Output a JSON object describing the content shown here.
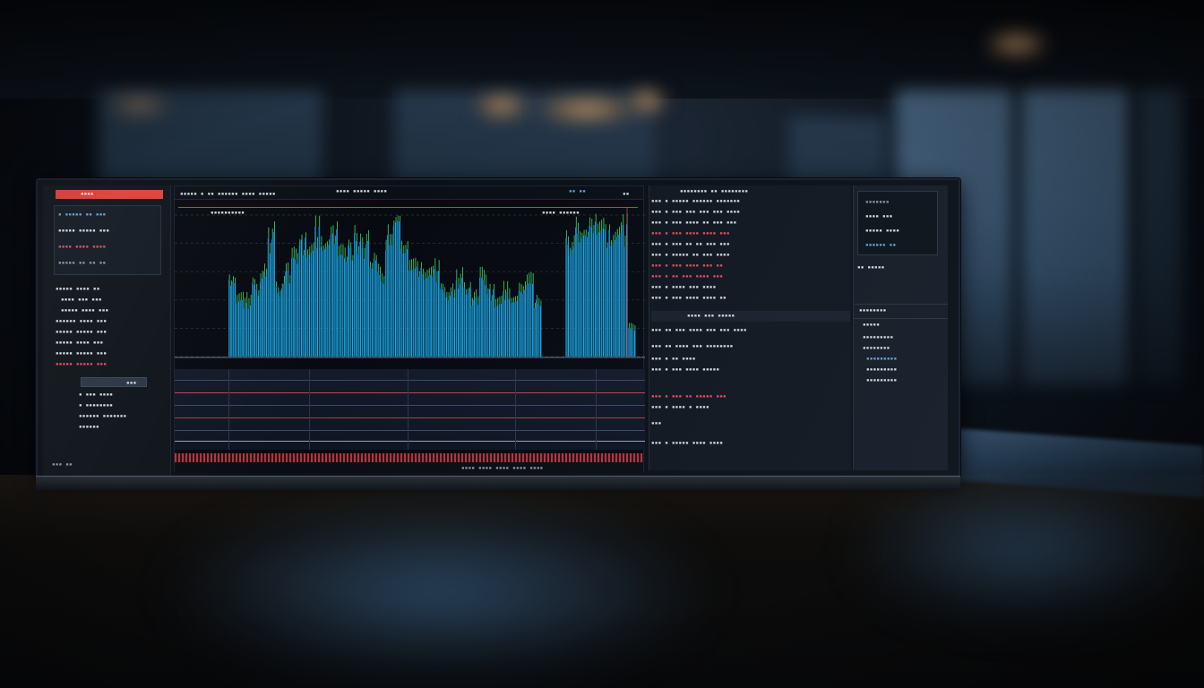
{
  "scene": {
    "colors": {
      "accent_red": "#e0413c",
      "bar_blue": "#1aa3e0",
      "bar_highlight": "#3ddc6a",
      "background": "#05070b"
    }
  },
  "header": {
    "left_title": "▪▪▪▪",
    "center_title": "▪▪▪▪ ▪▪▪▪▪ ▪▪▪▪",
    "tab_a": "▪▪▪▪▪ ▪ ▪▪ ▪▪▪▪▪▪ ▪▪▪▪ ▪▪▪▪▪",
    "tab_b": "▪▪ ▪▪",
    "right_tag": "▪▪"
  },
  "left_panel": {
    "rows": [
      "▪ ▪▪▪▪▪  ▪▪ ▪▪▪",
      "▪▪▪▪▪ ▪▪▪▪▪ ▪▪▪",
      "▪▪▪▪ ▪▪▪▪ ▪▪▪▪",
      "▪▪▪▪▪ ▪▪ ▪▪ ▪▪"
    ],
    "list": [
      "▪▪▪▪▪   ▪▪▪▪   ▪▪",
      "▪▪▪▪   ▪▪▪   ▪▪▪",
      "▪▪▪▪▪   ▪▪▪▪   ▪▪▪",
      "▪▪▪▪▪▪  ▪▪▪▪   ▪▪▪",
      "▪▪▪▪▪   ▪▪▪▪▪  ▪▪▪",
      "▪▪▪▪▪   ▪▪▪▪   ▪▪▪",
      "▪▪▪▪▪   ▪▪▪▪▪  ▪▪▪",
      "▪▪▪▪▪   ▪▪▪▪▪  ▪▪▪"
    ],
    "button_label": "▪▪▪",
    "footer_rows": [
      "▪ ▪▪▪ ▪▪▪▪",
      "▪ ▪▪▪▪▪▪▪▪",
      "▪▪▪▪▪▪ ▪▪▪▪▪▪▪",
      "▪▪▪▪▪▪"
    ],
    "footer_status": "▪▪▪ ▪▪"
  },
  "chart_data": {
    "type": "bar",
    "title": "",
    "xlabel": "",
    "ylabel": "",
    "values": [
      55,
      40,
      38,
      52,
      60,
      88,
      50,
      62,
      70,
      84,
      78,
      92,
      85,
      90,
      72,
      80,
      88,
      82,
      70,
      60,
      86,
      96,
      78,
      72,
      64,
      58,
      62,
      48,
      46,
      56,
      50,
      42,
      56,
      48,
      38,
      46,
      44,
      48,
      52,
      40,
      0,
      0,
      0,
      84,
      92,
      86,
      96,
      100,
      90,
      88,
      94,
      20
    ],
    "highlight_color": "#3ddc6a",
    "bar_color": "#1aa3e0",
    "ylim": [
      0,
      100
    ],
    "grid": true
  },
  "chart_labels": {
    "top_left": "▪▪▪▪▪▪▪▪▪▪",
    "top_right": "▪▪▪▪ ▪▪▪▪▪▪",
    "footer": "▪▪▪▪ ▪▪▪▪ ▪▪▪▪ ▪▪▪▪ ▪▪▪▪"
  },
  "trade_panel": {
    "header": "▪▪▪▪▪▪▪▪ ▪▪ ▪▪▪▪▪▪▪▪",
    "rows_top": [
      "▪▪▪  ▪  ▪▪▪▪▪  ▪▪▪▪▪▪ ▪▪▪▪▪▪▪",
      "▪▪▪  ▪  ▪▪▪ ▪▪▪ ▪▪▪ ▪▪▪ ▪▪▪▪",
      "▪▪▪  ▪  ▪▪▪ ▪▪▪▪ ▪▪ ▪▪▪ ▪▪▪",
      "▪▪▪  ▪  ▪▪▪ ▪▪▪▪ ▪▪▪▪ ▪▪▪",
      "▪▪▪  ▪  ▪▪▪ ▪▪ ▪▪ ▪▪▪ ▪▪▪",
      "▪▪▪  ▪  ▪▪▪▪▪ ▪▪ ▪▪▪ ▪▪▪▪",
      "▪▪▪  ▪  ▪▪▪ ▪▪▪▪ ▪▪▪ ▪▪",
      "▪▪▪  ▪  ▪▪ ▪▪▪ ▪▪▪▪ ▪▪▪",
      "▪▪▪  ▪  ▪▪▪▪ ▪▪▪ ▪▪▪▪",
      "▪▪▪  ▪  ▪▪▪ ▪▪▪▪ ▪▪▪▪ ▪▪"
    ],
    "subheader": "▪▪▪▪ ▪▪▪ ▪▪▪▪▪",
    "rows_bottom": [
      "▪▪▪  ▪▪  ▪▪▪ ▪▪▪▪ ▪▪▪ ▪▪▪ ▪▪▪▪",
      "▪▪▪  ▪▪  ▪▪▪▪ ▪▪▪ ▪▪▪▪▪▪▪▪",
      "▪▪▪  ▪   ▪▪ ▪▪▪▪",
      "▪▪▪  ▪   ▪▪▪ ▪▪▪▪ ▪▪▪▪▪",
      "▪▪▪  ▪   ▪▪▪ ▪▪ ▪▪▪▪▪ ▪▪▪",
      "▪▪▪  ▪   ▪▪▪▪ ▪ ▪▪▪▪",
      "▪▪▪",
      "▪▪▪  ▪   ▪▪▪▪▪ ▪▪▪▪ ▪▪▪▪"
    ]
  },
  "info_panel": {
    "card_lines": [
      "▪▪▪▪▪▪▪",
      "▪▪▪▪ ▪▪▪",
      "▪▪▪▪▪ ▪▪▪▪",
      "▪▪▪▪▪▪ ▪▪"
    ],
    "caption": "▪▪ ▪▪▪▪▪",
    "section": "▪▪▪▪▪▪▪▪",
    "sub": "▪▪▪▪▪",
    "items": [
      "▪▪▪▪▪▪▪▪▪",
      "▪▪▪▪▪▪▪▪",
      "▪▪▪▪▪▪▪▪▪",
      "▪▪▪▪▪▪▪▪▪"
    ]
  }
}
